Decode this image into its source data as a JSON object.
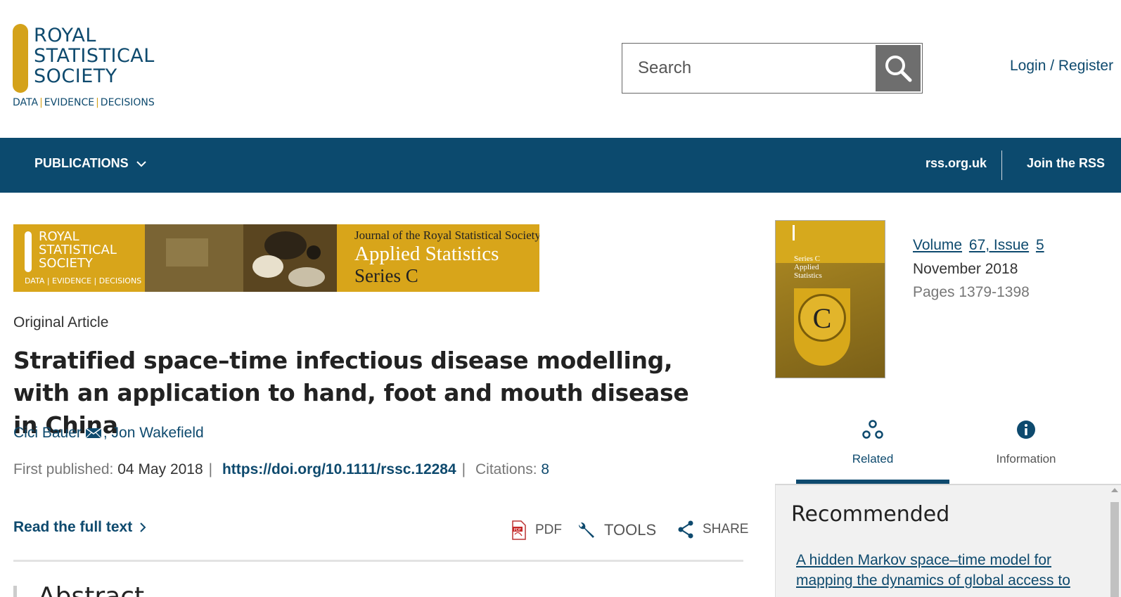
{
  "header": {
    "logo": {
      "lines": [
        "ROYAL",
        "STATISTICAL",
        "SOCIETY"
      ],
      "tagline": [
        "DATA",
        "EVIDENCE",
        "DECISIONS"
      ]
    },
    "search": {
      "placeholder": "Search"
    },
    "login_label": "Login / Register"
  },
  "nav": {
    "publications_label": "PUBLICATIONS",
    "site_link": "rss.org.uk",
    "join_link": "Join the RSS"
  },
  "banner": {
    "journal_line": "Journal of the Royal Statistical Society",
    "journal_title": "Applied Statistics",
    "series": "Series C",
    "logo_text": "ROYAL\nSTATISTICAL\nSOCIETY",
    "logo_tag": "DATA | EVIDENCE | DECISIONS"
  },
  "article": {
    "type": "Original Article",
    "title": "Stratified space–time infectious disease modelling, with an application to hand, foot and mouth disease in China",
    "authors": [
      "Cici Bauer",
      "Jon Wakefield"
    ],
    "first_published_label": "First published:",
    "first_published_date": "04 May 2018",
    "doi": "https://doi.org/10.1111/rssc.12284",
    "citations_label": "Citations:",
    "citations_count": "8",
    "read_full_text": "Read the full text",
    "abstract_heading": "Abstract"
  },
  "toolbar": {
    "pdf_label": "PDF",
    "tools_label": "TOOLS",
    "share_label": "SHARE"
  },
  "sidebar": {
    "volume_label": "Volume",
    "volume_number": "67, Issue",
    "issue_number": "5",
    "issue_date": "November 2018",
    "pages": "Pages 1379-1398",
    "cover_series": "Series C\nApplied\nStatistics",
    "tabs": [
      {
        "label": "Related",
        "active": true
      },
      {
        "label": "Information",
        "active": false
      }
    ],
    "recommended_heading": "Recommended",
    "recommended_first": "A hidden Markov space–time model for mapping the dynamics of global access to"
  },
  "colors": {
    "brand_blue": "#0c4a6e",
    "brand_gold": "#d4a21a"
  }
}
